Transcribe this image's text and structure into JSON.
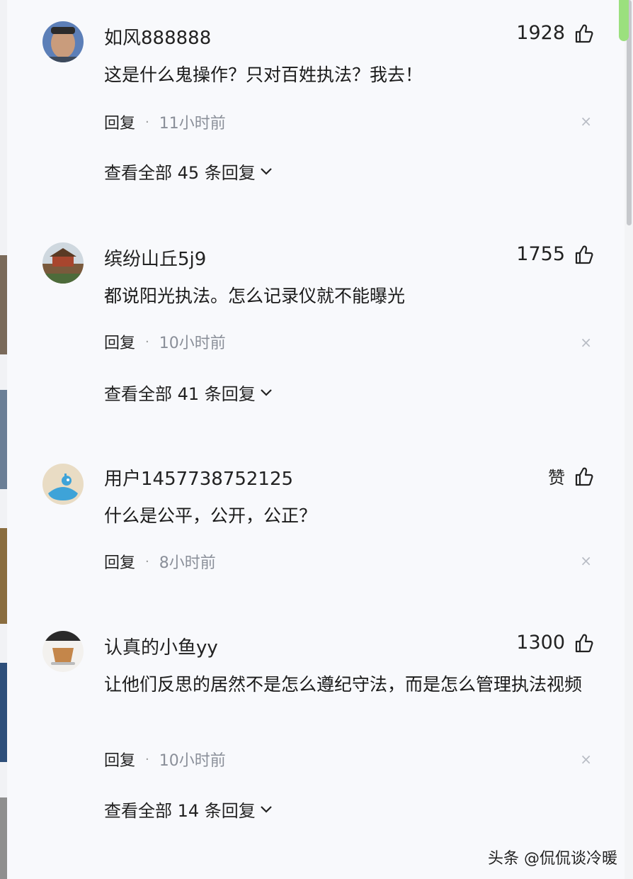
{
  "comments": [
    {
      "username": "如风888888",
      "likes": "1928",
      "text": "这是什么鬼操作？只对百姓执法？我去！",
      "reply_label": "回复",
      "time": "11小时前",
      "view_replies": "查看全部 45 条回复"
    },
    {
      "username": "缤纷山丘5j9",
      "likes": "1755",
      "text": "都说阳光执法。怎么记录仪就不能曝光",
      "reply_label": "回复",
      "time": "10小时前",
      "view_replies": "查看全部 41 条回复"
    },
    {
      "username": "用户1457738752125",
      "likes": "赞",
      "text": "什么是公平，公开，公正？",
      "reply_label": "回复",
      "time": "8小时前",
      "view_replies": ""
    },
    {
      "username": "认真的小鱼yy",
      "likes": "1300",
      "text": "让他们反思的居然不是怎么遵纪守法，而是怎么管理执法视频",
      "reply_label": "回复",
      "time": "10小时前",
      "view_replies": "查看全部 14 条回复"
    }
  ],
  "separator": "·",
  "close_glyph": "×",
  "icons": {
    "like": "thumbs-up-icon",
    "close": "close-icon",
    "expand": "chevron-down-icon"
  },
  "watermark": "头条 @侃侃谈冷暖",
  "colors": {
    "background": "#f8f9fc",
    "muted_text": "#8a8f99",
    "scroll_accent": "#9be07e"
  }
}
